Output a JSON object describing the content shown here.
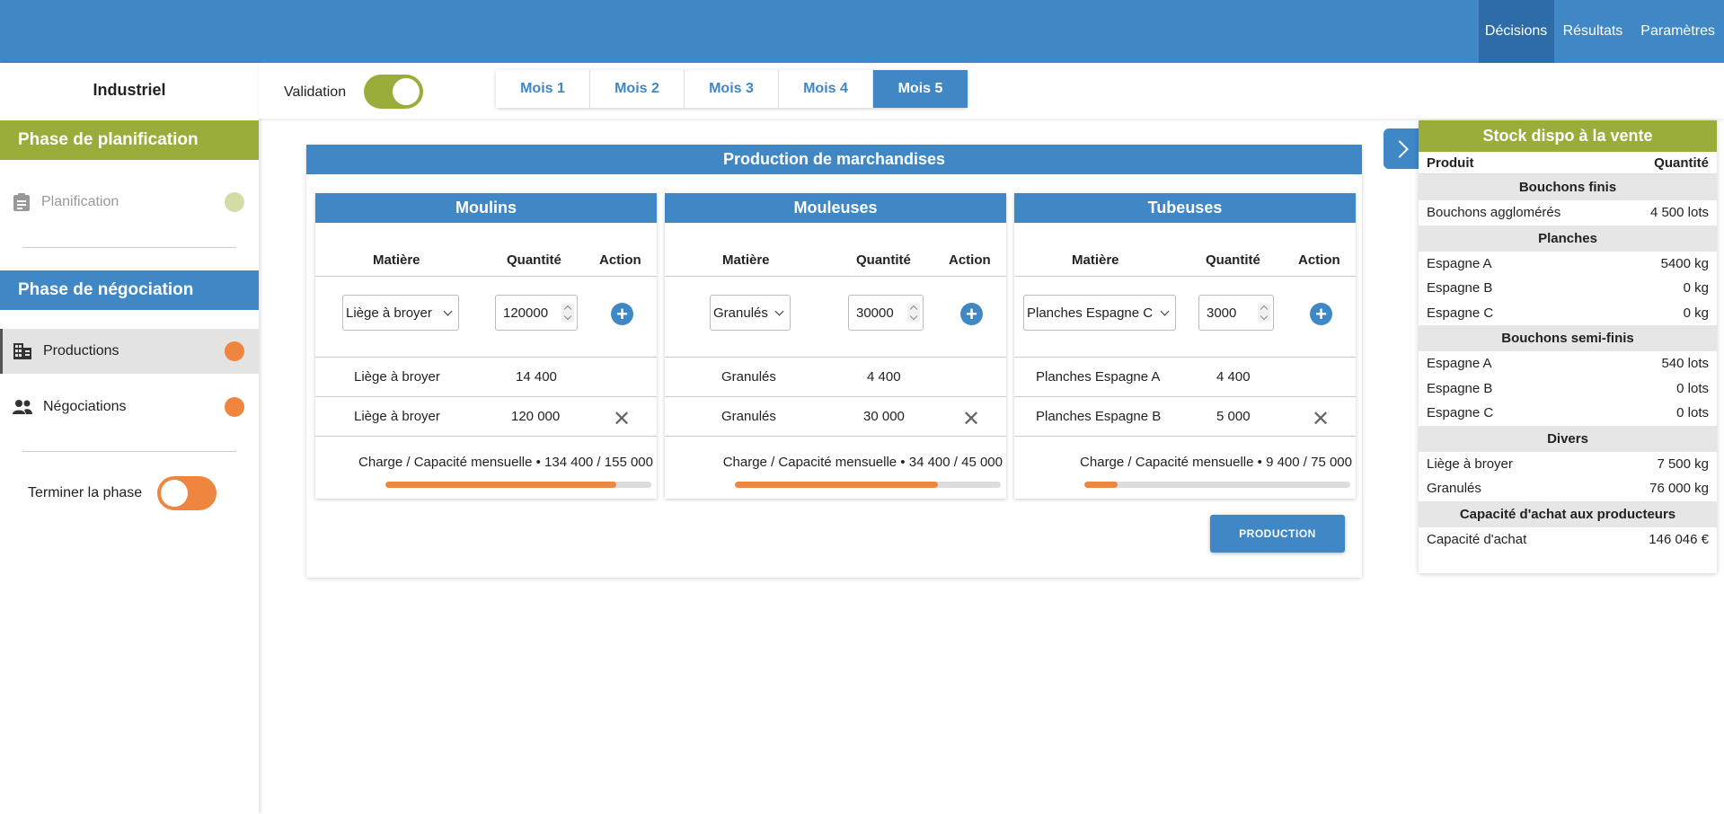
{
  "topnav": {
    "items": [
      "Décisions",
      "Résultats",
      "Paramètres"
    ]
  },
  "sidebar": {
    "title": "Industriel",
    "planning_phase": "Phase de planification",
    "planning_item": "Planification",
    "negotiation_phase": "Phase de négociation",
    "productions_item": "Productions",
    "negotiations_item": "Négociations",
    "finish_label": "Terminer la phase"
  },
  "header": {
    "validation_label": "Validation",
    "tabs": [
      "Mois 1",
      "Mois 2",
      "Mois 3",
      "Mois 4",
      "Mois 5"
    ],
    "active_tab": "Mois 5"
  },
  "production": {
    "title": "Production de marchandises",
    "columns": {
      "material": "Matière",
      "quantity": "Quantité",
      "action": "Action"
    },
    "machines": [
      {
        "name": "Moulins",
        "selected_material": "Liège à broyer",
        "input_quantity": "120000",
        "rows": [
          {
            "material": "Liège à broyer",
            "quantity": "14 400"
          },
          {
            "material": "Liège à broyer",
            "quantity": "120 000"
          }
        ],
        "charge": "Charge / Capacité mensuelle • 134 400 / 155 000",
        "load_fraction": 0.867
      },
      {
        "name": "Mouleuses",
        "selected_material": "Granulés",
        "input_quantity": "30000",
        "rows": [
          {
            "material": "Granulés",
            "quantity": "4 400"
          },
          {
            "material": "Granulés",
            "quantity": "30 000"
          }
        ],
        "charge": "Charge / Capacité mensuelle • 34 400 / 45 000",
        "load_fraction": 0.764
      },
      {
        "name": "Tubeuses",
        "selected_material": "Planches Espagne C",
        "input_quantity": "3000",
        "rows": [
          {
            "material": "Planches Espagne A",
            "quantity": "4 400"
          },
          {
            "material": "Planches Espagne B",
            "quantity": "5 000"
          }
        ],
        "charge": "Charge / Capacité mensuelle • 9 400 / 75 000",
        "load_fraction": 0.125
      }
    ],
    "button_label": "PRODUCTION"
  },
  "stock": {
    "title": "Stock dispo à la vente",
    "col_product": "Produit",
    "col_quantity": "Quantité",
    "sections": [
      {
        "name": "Bouchons finis",
        "rows": [
          {
            "label": "Bouchons agglomérés",
            "value": "4 500 lots"
          }
        ]
      },
      {
        "name": "Planches",
        "rows": [
          {
            "label": "Espagne A",
            "value": "5400 kg"
          },
          {
            "label": "Espagne B",
            "value": "0 kg"
          },
          {
            "label": "Espagne C",
            "value": "0 kg"
          }
        ]
      },
      {
        "name": "Bouchons semi-finis",
        "rows": [
          {
            "label": "Espagne A",
            "value": "540 lots"
          },
          {
            "label": "Espagne B",
            "value": "0 lots"
          },
          {
            "label": "Espagne C",
            "value": "0 lots"
          }
        ]
      },
      {
        "name": "Divers",
        "rows": [
          {
            "label": "Liège à broyer",
            "value": "7 500 kg"
          },
          {
            "label": "Granulés",
            "value": "76 000 kg"
          }
        ]
      },
      {
        "name": "Capacité d'achat aux producteurs",
        "rows": [
          {
            "label": "Capacité d'achat",
            "value": "146 046 €"
          }
        ]
      }
    ]
  },
  "colors": {
    "primary_blue": "#3f87c5",
    "green": "#9aad3b",
    "orange": "#ef8640"
  }
}
